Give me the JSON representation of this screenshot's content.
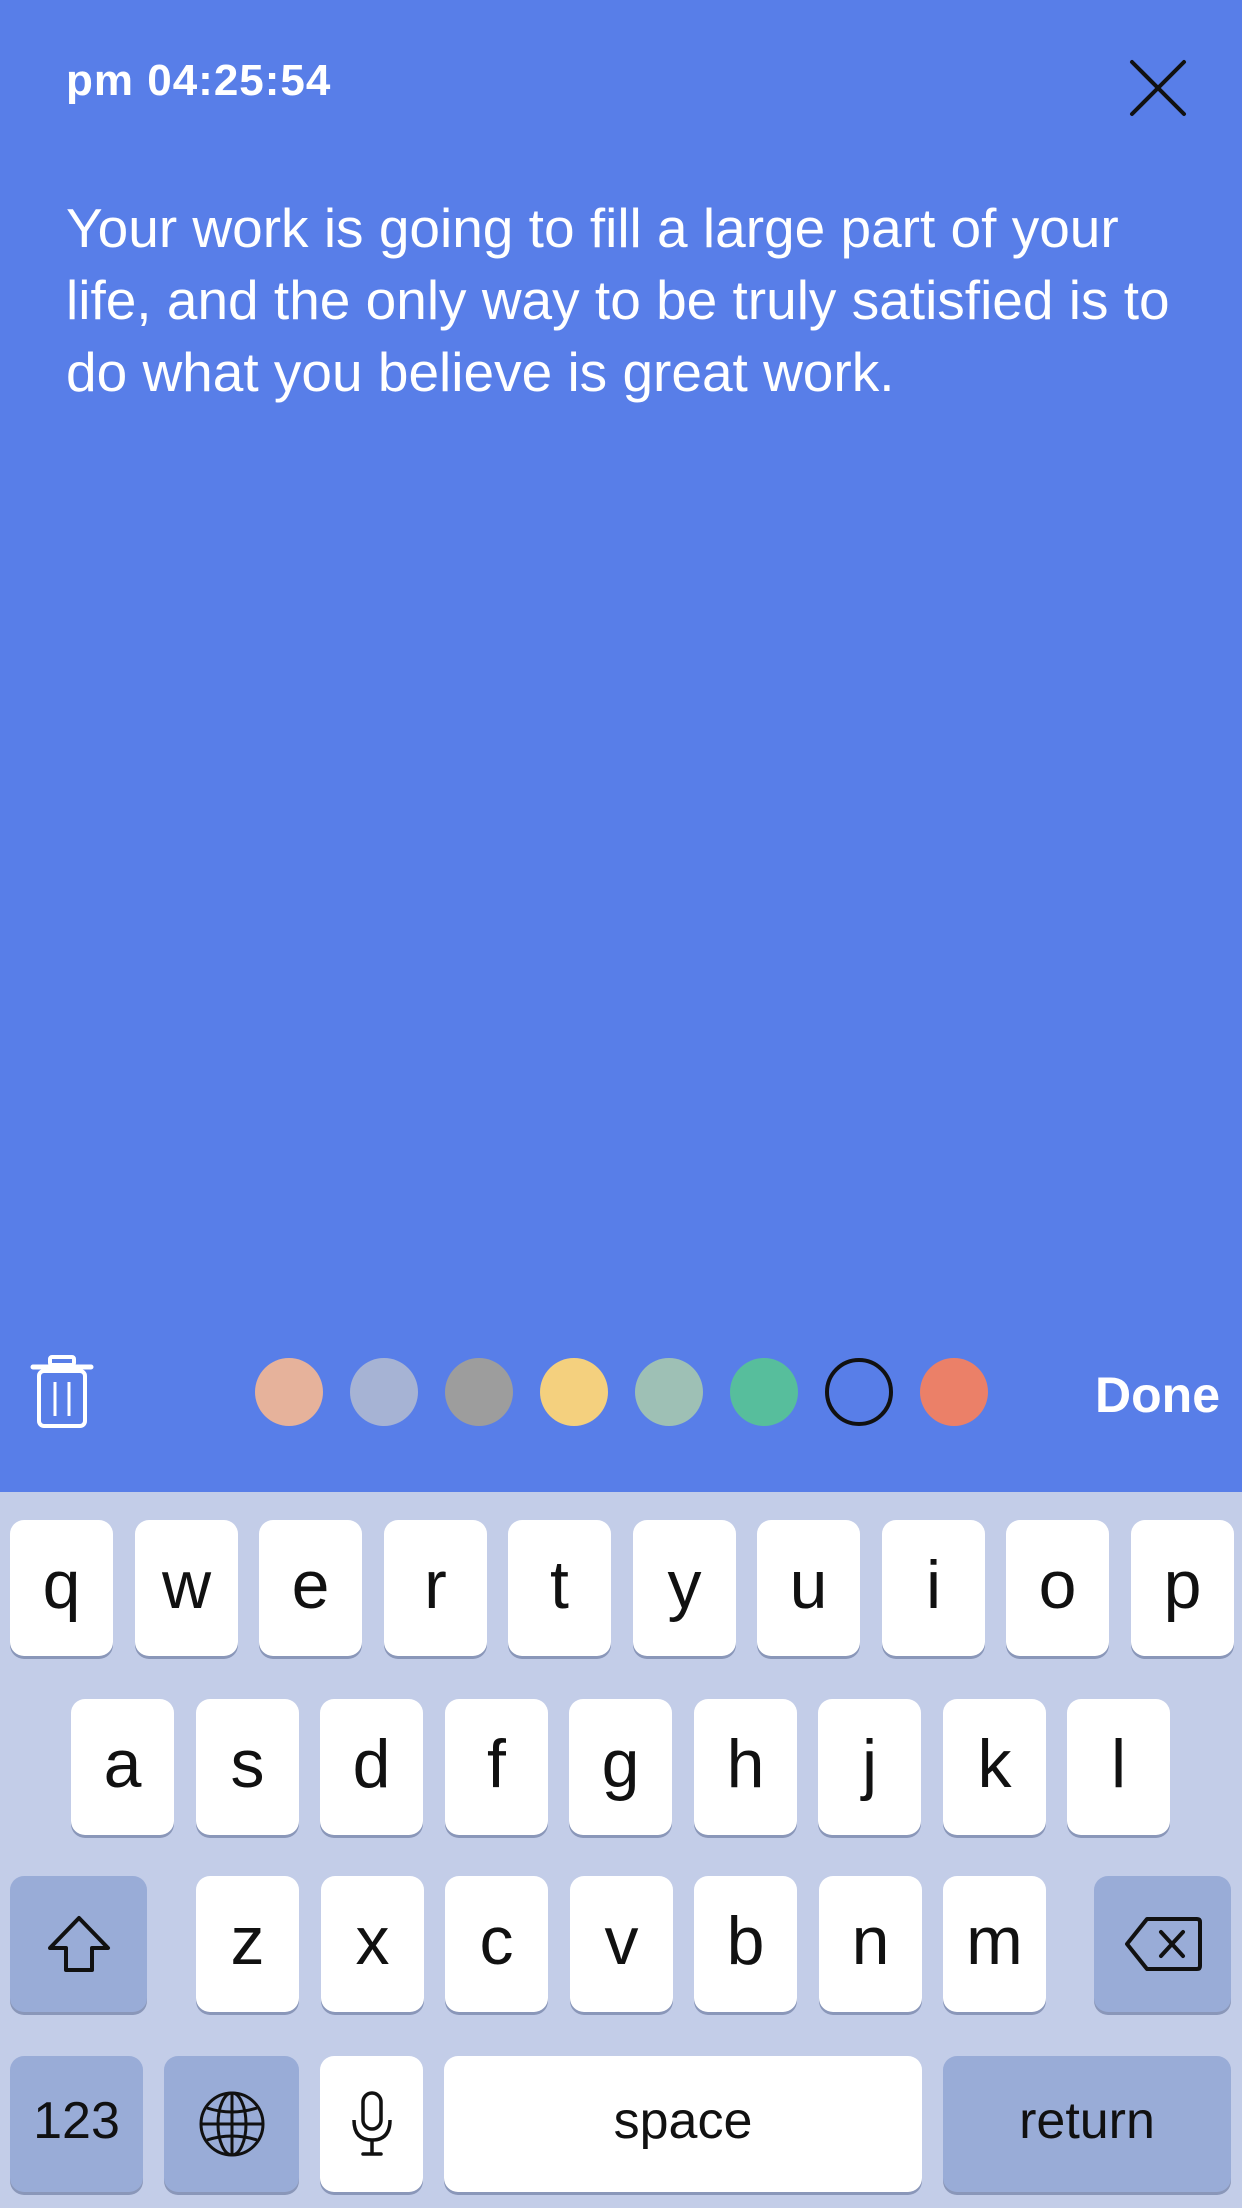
{
  "header": {
    "time": "pm 04:25:54"
  },
  "note": {
    "text": "Your work is going to fill a large part of your life, and the only way to be truly satisfied is to do what you believe is great work."
  },
  "toolbar": {
    "trash_icon": "trash-icon",
    "close_icon": "close-icon",
    "done_label": "Done",
    "swatches": [
      {
        "color": "#e6b29b",
        "selected": false
      },
      {
        "color": "#a6b3d4",
        "selected": false
      },
      {
        "color": "#9d9d9d",
        "selected": false
      },
      {
        "color": "#f4d07e",
        "selected": false
      },
      {
        "color": "#9ec0b5",
        "selected": false
      },
      {
        "color": "#57be9c",
        "selected": false
      },
      {
        "color": "#587ee8",
        "selected": true
      },
      {
        "color": "#eb8068",
        "selected": false
      }
    ]
  },
  "keyboard": {
    "row1": [
      "q",
      "w",
      "e",
      "r",
      "t",
      "y",
      "u",
      "i",
      "o",
      "p"
    ],
    "row2": [
      "a",
      "s",
      "d",
      "f",
      "g",
      "h",
      "j",
      "k",
      "l"
    ],
    "row3": [
      "z",
      "x",
      "c",
      "v",
      "b",
      "n",
      "m"
    ],
    "numbers_label": "123",
    "space_label": "space",
    "return_label": "return",
    "shift_icon": "shift-icon",
    "delete_icon": "delete-icon",
    "globe_icon": "globe-icon",
    "mic_icon": "microphone-icon"
  },
  "colors": {
    "background": "#587ee8",
    "keyboard_bg": "#c3cde8",
    "key_dark": "#99acd7"
  }
}
